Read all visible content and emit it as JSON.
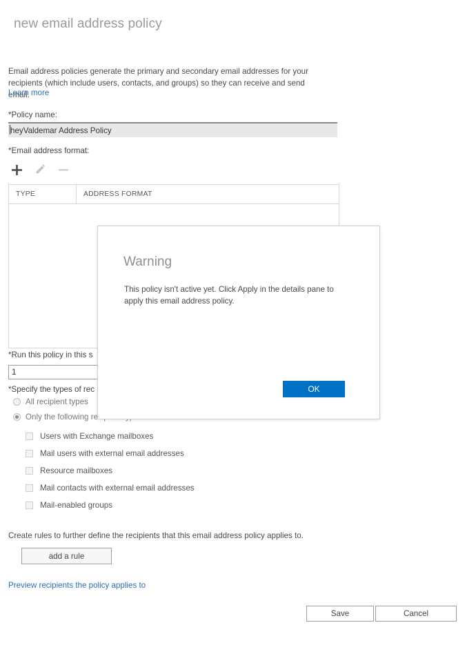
{
  "page": {
    "title": "new email address policy",
    "intro": "Email address policies generate the primary and secondary email addresses for your recipients (which include users, contacts, and groups) so they can receive and send email.",
    "learn_more_label": "Learn more"
  },
  "policy_name": {
    "label": "*Policy name:",
    "value": "heyValdemar Address Policy",
    "placeholder": ""
  },
  "email_format": {
    "label": "*Email address format:",
    "toolbar": {
      "add_icon": "plus-icon",
      "edit_icon": "pencil-icon",
      "remove_icon": "minus-icon"
    },
    "columns": [
      "TYPE",
      "ADDRESS FORMAT"
    ],
    "rows": []
  },
  "sequence": {
    "label": "*Run this policy in this s",
    "value": "1"
  },
  "recipients": {
    "label": "*Specify the types of rec",
    "options": [
      {
        "label": "All recipient types",
        "selected": false
      },
      {
        "label": "Only the following recipient types:",
        "selected": true
      }
    ],
    "checkboxes": [
      {
        "label": "Users with Exchange mailboxes",
        "checked": false
      },
      {
        "label": "Mail users with external email addresses",
        "checked": false
      },
      {
        "label": "Resource mailboxes",
        "checked": false
      },
      {
        "label": "Mail contacts with external email addresses",
        "checked": false
      },
      {
        "label": "Mail-enabled groups",
        "checked": false
      }
    ]
  },
  "rules": {
    "description": "Create rules to further define the recipients that this email address policy applies to.",
    "add_rule_label": "add a rule",
    "preview_link_label": "Preview recipients the policy applies to"
  },
  "footer": {
    "save_label": "Save",
    "cancel_label": "Cancel"
  },
  "dialog": {
    "title": "Warning",
    "message": "This policy isn't active yet. Click Apply in the details pane to apply this email address policy.",
    "ok_label": "OK",
    "accent_color": "#0072c6"
  }
}
